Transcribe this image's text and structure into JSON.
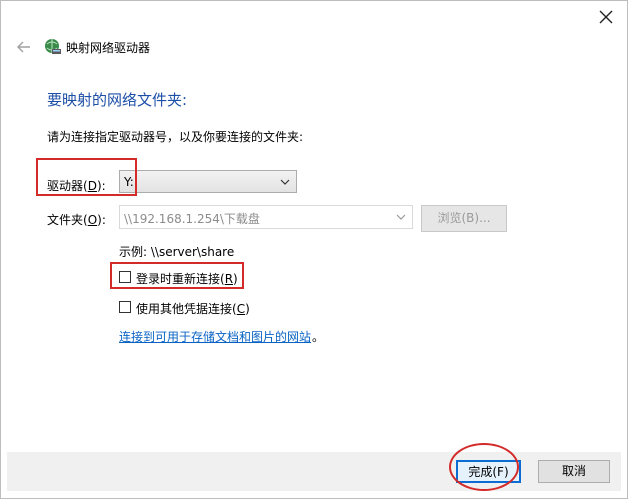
{
  "window": {
    "title": "映射网络驱动器"
  },
  "main": {
    "heading": "要映射的网络文件夹:",
    "instruction": "请为连接指定驱动器号，以及你要连接的文件夹:",
    "drive": {
      "label": "驱动器",
      "hotkey": "D",
      "label_suffix": "):",
      "value": "Y:"
    },
    "folder": {
      "label": "文件夹",
      "hotkey": "O",
      "label_suffix": "):",
      "value": "\\\\192.168.1.254\\下载盘",
      "browse_label": "浏览(B)..."
    },
    "example": "示例: \\\\server\\share",
    "reconnect": {
      "label": "登录时重新连接",
      "hotkey": "R",
      "checked": false
    },
    "other_credentials": {
      "label": "使用其他凭据连接",
      "hotkey": "C",
      "checked": false
    },
    "link_text": "连接到可用于存储文档和图片的网站",
    "link_suffix": "。"
  },
  "footer": {
    "finish_label": "完成(F)",
    "cancel_label": "取消"
  },
  "colors": {
    "accent": "#1d4fa7",
    "link": "#0a63c4",
    "annotation": "#d32a2a"
  },
  "icons": [
    "close-icon",
    "back-arrow-icon",
    "network-drive-icon",
    "chevron-down-icon"
  ]
}
